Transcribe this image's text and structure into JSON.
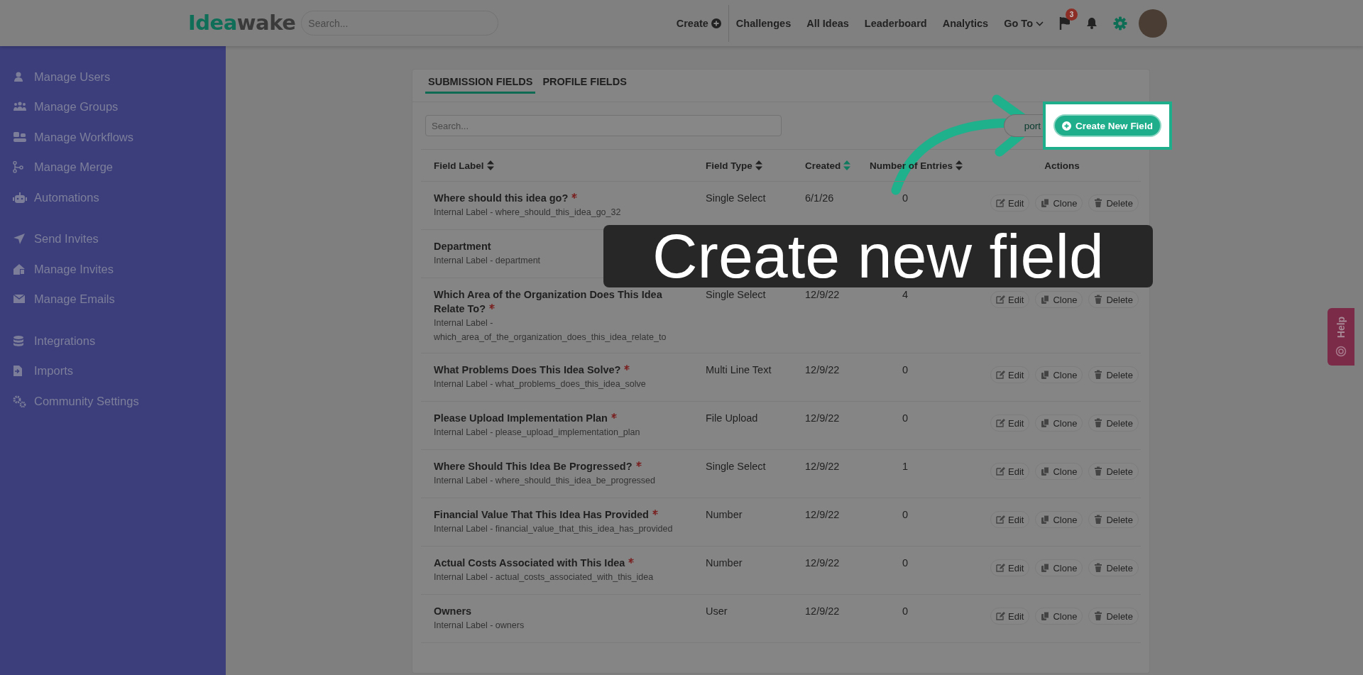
{
  "logo": {
    "lead": "Idea",
    "rest": "wake"
  },
  "top_search": {
    "placeholder": "Search..."
  },
  "nav": [
    {
      "label": "Create",
      "kind": "create"
    },
    {
      "label": "Challenges",
      "kind": "link"
    },
    {
      "label": "All Ideas",
      "kind": "link"
    },
    {
      "label": "Leaderboard",
      "kind": "link"
    },
    {
      "label": "Analytics",
      "kind": "link"
    },
    {
      "label": "Go To",
      "kind": "dropdown"
    }
  ],
  "notification_badge": "3",
  "sidebar": {
    "groups": [
      [
        {
          "label": "Manage Users"
        },
        {
          "label": "Manage Groups"
        },
        {
          "label": "Manage Workflows"
        },
        {
          "label": "Manage Merge"
        },
        {
          "label": "Automations"
        }
      ],
      [
        {
          "label": "Send Invites"
        },
        {
          "label": "Manage Invites"
        },
        {
          "label": "Manage Emails"
        }
      ],
      [
        {
          "label": "Integrations"
        },
        {
          "label": "Imports"
        },
        {
          "label": "Community Settings"
        }
      ]
    ]
  },
  "tabs": [
    {
      "label": "SUBMISSION FIELDS",
      "selected": true
    },
    {
      "label": "PROFILE FIELDS",
      "selected": false
    }
  ],
  "table_search": {
    "placeholder": "Search..."
  },
  "export_button": "port",
  "create_button": "Create New Field",
  "table": {
    "columns": [
      {
        "label": "Field Label",
        "sorted": false
      },
      {
        "label": "Field Type",
        "sorted": false
      },
      {
        "label": "Created",
        "sorted": true
      },
      {
        "label": "Number of Entries",
        "sorted": false
      },
      {
        "label": "Actions"
      }
    ],
    "rows": [
      {
        "title": "Where should this idea go?",
        "required": true,
        "internal_label": "Internal Label - where_should_this_idea_go_32",
        "type": "Single Select",
        "created": "6/1/26",
        "entries": "0",
        "actions": [
          "Edit",
          "Clone",
          "Delete"
        ]
      },
      {
        "title": "Department",
        "required": false,
        "internal_label": "Internal Label - department"
      },
      {
        "title": "Which Area of the Organization Does This Idea Relate To?",
        "required": true,
        "internal_label": "Internal Label - which_area_of_the_organization_does_this_idea_relate_to",
        "type": "Single Select",
        "created": "12/9/22",
        "entries": "4",
        "actions": [
          "Edit",
          "Clone",
          "Delete"
        ]
      },
      {
        "title": "What Problems Does This Idea Solve?",
        "required": true,
        "internal_label": "Internal Label - what_problems_does_this_idea_solve",
        "type": "Multi Line Text",
        "created": "12/9/22",
        "entries": "0",
        "actions": [
          "Edit",
          "Clone",
          "Delete"
        ]
      },
      {
        "title": "Please Upload Implementation Plan",
        "required": true,
        "internal_label": "Internal Label - please_upload_implementation_plan",
        "type": "File Upload",
        "created": "12/9/22",
        "entries": "0",
        "actions": [
          "Edit",
          "Clone",
          "Delete"
        ]
      },
      {
        "title": "Where Should This Idea Be Progressed?",
        "required": true,
        "internal_label": "Internal Label - where_should_this_idea_be_progressed",
        "type": "Single Select",
        "created": "12/9/22",
        "entries": "1",
        "actions": [
          "Edit",
          "Clone",
          "Delete"
        ]
      },
      {
        "title": "Financial Value That This Idea Has Provided",
        "required": true,
        "internal_label": "Internal Label - financial_value_that_this_idea_has_provided",
        "type": "Number",
        "created": "12/9/22",
        "entries": "0",
        "actions": [
          "Edit",
          "Clone",
          "Delete"
        ]
      },
      {
        "title": "Actual Costs Associated with This Idea",
        "required": true,
        "internal_label": "Internal Label - actual_costs_associated_with_this_idea",
        "type": "Number",
        "created": "12/9/22",
        "entries": "0",
        "actions": [
          "Edit",
          "Clone",
          "Delete"
        ]
      },
      {
        "title": "Owners",
        "required": false,
        "internal_label": "Internal Label - owners",
        "type": "User",
        "created": "12/9/22",
        "entries": "0",
        "actions": [
          "Edit",
          "Clone",
          "Delete"
        ]
      }
    ]
  },
  "callout": {
    "text": "Create new field"
  },
  "help_tab": "Help"
}
